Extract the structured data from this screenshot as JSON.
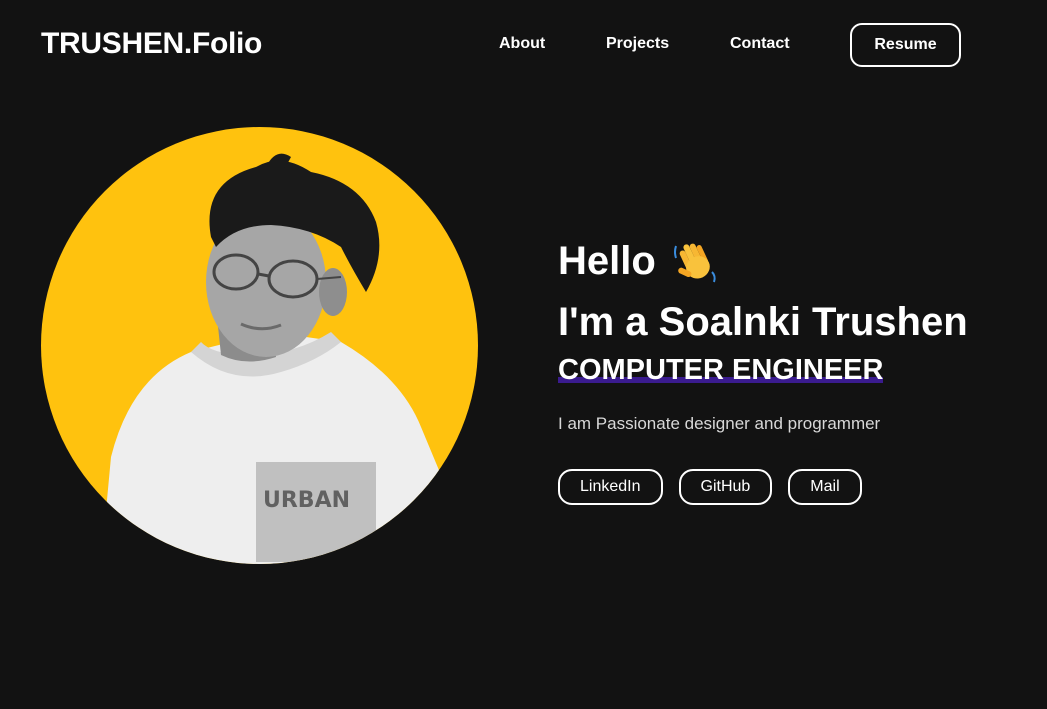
{
  "header": {
    "brand": "TRUSHEN.Folio",
    "nav": {
      "about": "About",
      "projects": "Projects",
      "contact": "Contact",
      "resume": "Resume"
    }
  },
  "hero": {
    "greeting": "Hello",
    "greeting_icon": "waving-hand-icon",
    "intro": "I'm a Soalnki Trushen",
    "role": "COMPUTER ENGINEER",
    "tagline": "I am Passionate designer and programmer",
    "socials": {
      "linkedin": "LinkedIn",
      "github": "GitHub",
      "mail": "Mail"
    }
  },
  "colors": {
    "background": "#121212",
    "portrait_circle": "#ffc20e",
    "role_highlight": "#3a1b8f",
    "text": "#ffffff"
  }
}
